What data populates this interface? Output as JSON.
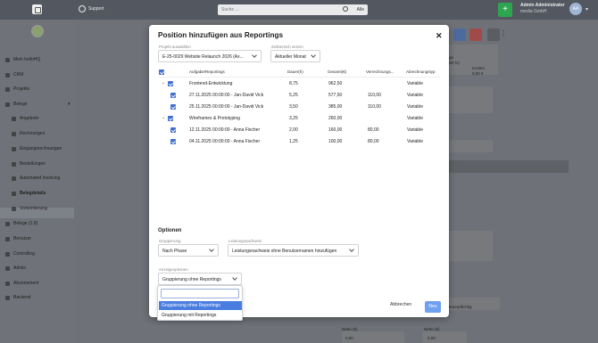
{
  "topbar": {
    "support_label": "Support",
    "search_placeholder": "Suche ...",
    "search_scope": "Alle",
    "plus_label": "+",
    "user_name": "Admin Administrator",
    "user_company": "media GmbH",
    "user_initials": "AA"
  },
  "sidebar": {
    "items": [
      {
        "label": "Mein helloHQ"
      },
      {
        "label": "CRM"
      },
      {
        "label": "Projekte"
      },
      {
        "label": "Belege"
      },
      {
        "label": "Angebote"
      },
      {
        "label": "Rechnungen"
      },
      {
        "label": "Eingangsrechnungen"
      },
      {
        "label": "Bestellungen"
      },
      {
        "label": "Automated Invoicing"
      },
      {
        "label": "Belegdetails"
      },
      {
        "label": "Vorkontierung"
      },
      {
        "label": "Belege (1.9)"
      },
      {
        "label": "Benutzer"
      },
      {
        "label": "Controlling"
      },
      {
        "label": "Admin"
      },
      {
        "label": "Abonnement"
      },
      {
        "label": "Backend"
      }
    ]
  },
  "background": {
    "right_text_1": "ge",
    "right_text_2": "00 %)",
    "right_text_3": "Kosten",
    "right_text_4": "0,00 €",
    "steuer_label": "teuerpflichtig",
    "betrag_label_1": "Netto (€)",
    "betrag_label_2": "Netto (€)",
    "betrag_value_1": "0,00",
    "betrag_value_2": "0,00"
  },
  "modal": {
    "title": "Position hinzufügen aus Reportings",
    "project_label": "Projekt auswählen",
    "project_value": "E-25-0029 Website Relaunch 2026 (Ax...",
    "period_label": "Zeitbereich setzen",
    "period_value": "Aktueller Monat",
    "columns": {
      "task": "Aufgabe/Reportings",
      "duration": "Dauer(h)",
      "total": "Gesamt(€)",
      "billing": "Verrechnungs...",
      "type": "Abrechnungstyp"
    },
    "rows": [
      {
        "task": "Frontend-Entwicklung",
        "duration": "8,75",
        "total": "962,50",
        "billing": "",
        "type": "Variable"
      },
      {
        "task": "27.11.2025 00:00:00 - Jan-David Vick",
        "duration": "5,25",
        "total": "577,50",
        "billing": "110,00",
        "type": "Variable"
      },
      {
        "task": "25.11.2025 00:00:00 - Jan-David Vick",
        "duration": "3,50",
        "total": "385,00",
        "billing": "110,00",
        "type": "Variable"
      },
      {
        "task": "Wireframes & Prototyping",
        "duration": "3,25",
        "total": "260,00",
        "billing": "",
        "type": "Variable"
      },
      {
        "task": "12.11.2025 00:00:00 - Anna Fischer",
        "duration": "2,00",
        "total": "160,00",
        "billing": "80,00",
        "type": "Variable"
      },
      {
        "task": "04.11.2025 00:00:00 - Anna Fischer",
        "duration": "1,25",
        "total": "100,00",
        "billing": "80,00",
        "type": "Variable"
      }
    ],
    "options_title": "Optionen",
    "grouping_label": "Gruppierung",
    "grouping_value": "Nach Phase",
    "proof_label": "Leistungsnachweis",
    "proof_value": "Leistungsnachweis ohne Benutzernamen hinzufügen",
    "display_label": "Anzeigeoptionen",
    "display_value": "Gruppierung ohne Reportings",
    "display_options": [
      "Gruppierung ohne Reportings",
      "Gruppierung mit Reportings"
    ],
    "cancel_label": "Abbrechen",
    "submit_label": "Neu"
  },
  "colors": {
    "accent": "#3f6fd1",
    "submit": "#6f9fef",
    "green": "#2ea64f"
  }
}
